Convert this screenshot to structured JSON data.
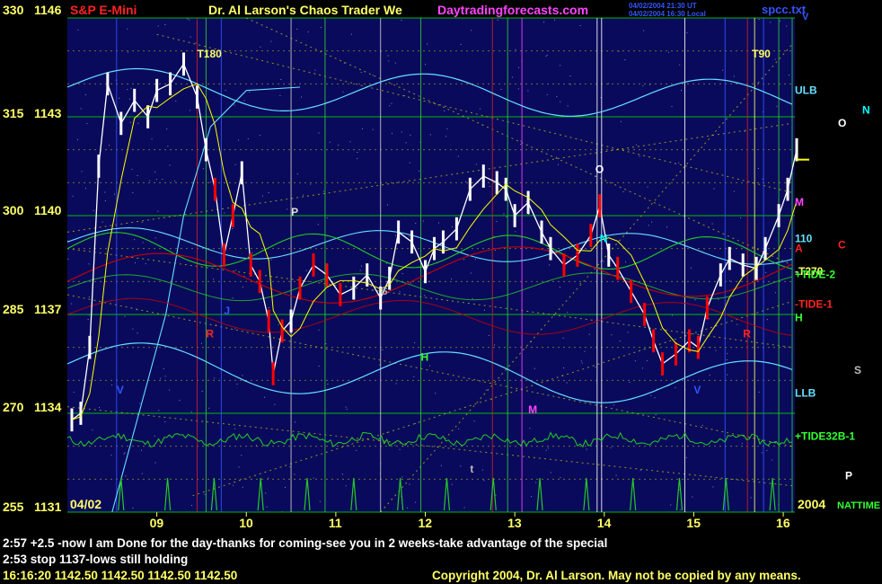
{
  "header": {
    "title_left": "S&P E-Mini",
    "title_main": "Dr. Al Larson's Chaos Trader We",
    "site": "Daytradingforecasts.com",
    "stamp1": "04/02/2004 21:30 UT",
    "stamp2": "04/02/2004 16:30 Local",
    "file": "spcc.txt",
    "corner": "V"
  },
  "footer": {
    "note1": "2:57 +2.5 -now I am Done for the day-thanks for coming-see you in 2 weeks-take advantage of the special",
    "note2": "2:53 stop 1137-lows still holding",
    "quote": "16:16:20  1142.50  1142.50  1142.50  1142.50",
    "copyright": "Copyright 2004, Dr. Al Larson. May not be copied by any means.",
    "date_left": "04/02",
    "year": "2004",
    "nattime": "NATTIME"
  },
  "colors": {
    "background": "#000000",
    "plot_bg": "#0a0a5c",
    "grid_green": "#00cc00",
    "grid_yellow": "#cccc00",
    "band_cyan": "#66e0ff",
    "price_white": "#ffffff",
    "price_red": "#ff0000",
    "red_line": "#cc0000",
    "green_line": "#22cc22",
    "magenta": "#ff44ff",
    "title_red": "#ff2222",
    "header_yellow": "#ffff66"
  },
  "chart_data": {
    "type": "line",
    "title": "S&P E-Mini",
    "y_axis_left": {
      "index_labels": [
        "330",
        "315",
        "300",
        "285",
        "270",
        "255"
      ],
      "price_labels": [
        "1146",
        "1143",
        "1140",
        "1137",
        "1134",
        "1131"
      ],
      "price_range": [
        1131,
        1146
      ]
    },
    "x_axis": {
      "tick_labels": [
        "09",
        "10",
        "11",
        "12",
        "13",
        "14",
        "15",
        "16"
      ]
    },
    "price_series": [
      {
        "t": 8.05,
        "p": 1133.8
      },
      {
        "t": 8.15,
        "p": 1134.0
      },
      {
        "t": 8.25,
        "p": 1136.0
      },
      {
        "t": 8.35,
        "p": 1141.5
      },
      {
        "t": 8.45,
        "p": 1144.0
      },
      {
        "t": 8.6,
        "p": 1142.8
      },
      {
        "t": 8.75,
        "p": 1143.5
      },
      {
        "t": 8.9,
        "p": 1143.0
      },
      {
        "t": 9.0,
        "p": 1143.8
      },
      {
        "t": 9.15,
        "p": 1144.0
      },
      {
        "t": 9.3,
        "p": 1144.6
      },
      {
        "t": 9.45,
        "p": 1143.6
      },
      {
        "t": 9.55,
        "p": 1142.0
      },
      {
        "t": 9.65,
        "p": 1140.8
      },
      {
        "t": 9.75,
        "p": 1138.8
      },
      {
        "t": 9.85,
        "p": 1140.0
      },
      {
        "t": 9.95,
        "p": 1141.3
      },
      {
        "t": 10.05,
        "p": 1138.5
      },
      {
        "t": 10.15,
        "p": 1138.0
      },
      {
        "t": 10.25,
        "p": 1136.8
      },
      {
        "t": 10.3,
        "p": 1135.2
      },
      {
        "t": 10.4,
        "p": 1136.5
      },
      {
        "t": 10.5,
        "p": 1136.8
      },
      {
        "t": 10.6,
        "p": 1137.8
      },
      {
        "t": 10.75,
        "p": 1138.5
      },
      {
        "t": 10.9,
        "p": 1138.2
      },
      {
        "t": 11.05,
        "p": 1137.6
      },
      {
        "t": 11.2,
        "p": 1137.8
      },
      {
        "t": 11.35,
        "p": 1138.2
      },
      {
        "t": 11.5,
        "p": 1137.5
      },
      {
        "t": 11.6,
        "p": 1138.1
      },
      {
        "t": 11.7,
        "p": 1139.5
      },
      {
        "t": 11.85,
        "p": 1139.2
      },
      {
        "t": 12.0,
        "p": 1138.3
      },
      {
        "t": 12.1,
        "p": 1139.0
      },
      {
        "t": 12.2,
        "p": 1139.2
      },
      {
        "t": 12.35,
        "p": 1139.6
      },
      {
        "t": 12.5,
        "p": 1140.8
      },
      {
        "t": 12.65,
        "p": 1141.2
      },
      {
        "t": 12.8,
        "p": 1141.0
      },
      {
        "t": 12.9,
        "p": 1140.8
      },
      {
        "t": 13.0,
        "p": 1140.0
      },
      {
        "t": 13.15,
        "p": 1140.4
      },
      {
        "t": 13.3,
        "p": 1139.5
      },
      {
        "t": 13.4,
        "p": 1139.0
      },
      {
        "t": 13.55,
        "p": 1138.5
      },
      {
        "t": 13.7,
        "p": 1138.8
      },
      {
        "t": 13.85,
        "p": 1139.4
      },
      {
        "t": 13.95,
        "p": 1140.3
      },
      {
        "t": 14.05,
        "p": 1138.8
      },
      {
        "t": 14.15,
        "p": 1138.4
      },
      {
        "t": 14.3,
        "p": 1137.7
      },
      {
        "t": 14.45,
        "p": 1137.0
      },
      {
        "t": 14.55,
        "p": 1136.2
      },
      {
        "t": 14.65,
        "p": 1135.5
      },
      {
        "t": 14.8,
        "p": 1135.8
      },
      {
        "t": 14.95,
        "p": 1136.2
      },
      {
        "t": 15.05,
        "p": 1136.0
      },
      {
        "t": 15.15,
        "p": 1137.2
      },
      {
        "t": 15.3,
        "p": 1138.2
      },
      {
        "t": 15.4,
        "p": 1138.7
      },
      {
        "t": 15.55,
        "p": 1138.5
      },
      {
        "t": 15.7,
        "p": 1138.4
      },
      {
        "t": 15.8,
        "p": 1139.0
      },
      {
        "t": 15.95,
        "p": 1140.0
      },
      {
        "t": 16.05,
        "p": 1140.8
      },
      {
        "t": 16.15,
        "p": 1142.0
      }
    ],
    "red_segments": [
      [
        9.6,
        9.9
      ],
      [
        10.05,
        10.4
      ],
      [
        10.6,
        11.05
      ],
      [
        13.5,
        13.95
      ],
      [
        14.1,
        15.2
      ]
    ],
    "annotations": [
      {
        "text": "T180",
        "t": 9.45,
        "p": 1144.8,
        "color": "#ffff66"
      },
      {
        "text": "T90",
        "t": 15.65,
        "p": 1144.8,
        "color": "#ffff66"
      },
      {
        "text": "P",
        "t": 10.5,
        "p": 1140.0,
        "color": "#dddddd"
      },
      {
        "text": "S",
        "t": 11.5,
        "p": 1137.6,
        "color": "#aaaaaa"
      },
      {
        "text": "O",
        "t": 13.9,
        "p": 1141.3,
        "color": "#ffffff"
      },
      {
        "text": "J",
        "t": 9.75,
        "p": 1137.0,
        "color": "#3355ff"
      },
      {
        "text": "R",
        "t": 9.55,
        "p": 1136.3,
        "color": "#ff2222"
      },
      {
        "text": "V",
        "t": 8.55,
        "p": 1134.6,
        "color": "#3355ff"
      },
      {
        "text": "H",
        "t": 11.95,
        "p": 1135.6,
        "color": "#33ff33"
      },
      {
        "text": "M",
        "t": 13.15,
        "p": 1134.0,
        "color": "#ff44ff"
      },
      {
        "text": "t",
        "t": 12.5,
        "p": 1132.2,
        "color": "#bbbbbb"
      },
      {
        "text": "N",
        "t": 13.95,
        "p": 1139.2,
        "color": "#00ffff"
      },
      {
        "text": "V",
        "t": 15.0,
        "p": 1134.6,
        "color": "#3355ff"
      },
      {
        "text": "R",
        "t": 15.55,
        "p": 1136.3,
        "color": "#ff2222"
      }
    ],
    "right_labels": [
      {
        "text": "ULB",
        "p": 1143.7,
        "color": "#66e0ff"
      },
      {
        "text": "LLB",
        "p": 1134.5,
        "color": "#66e0ff"
      },
      {
        "text": "M",
        "p": 1140.3,
        "color": "#ff44ff"
      },
      {
        "text": "110",
        "p": 1139.2,
        "color": "#66e0ff"
      },
      {
        "text": "A",
        "p": 1138.9,
        "color": "#ff2222"
      },
      {
        "text": "-T270",
        "p": 1138.2,
        "color": "#ffff66"
      },
      {
        "text": "+TIDE-2",
        "p": 1138.1,
        "color": "#33ff33"
      },
      {
        "text": "-TIDE-1",
        "p": 1137.2,
        "color": "#ff2222"
      },
      {
        "text": "H",
        "p": 1136.8,
        "color": "#33ff33"
      },
      {
        "text": "+TIDE32B-1",
        "p": 1133.2,
        "color": "#33ff33"
      }
    ],
    "far_right_labels": [
      {
        "text": "N",
        "p": 1143.1,
        "color": "#00ffff"
      },
      {
        "text": "O",
        "p": 1142.7,
        "color": "#ffffff"
      },
      {
        "text": "C",
        "p": 1139.0,
        "color": "#ff2222"
      },
      {
        "text": "S",
        "p": 1135.2,
        "color": "#bbbbbb"
      },
      {
        "text": "P",
        "p": 1132.0,
        "color": "#ffffff"
      }
    ]
  }
}
